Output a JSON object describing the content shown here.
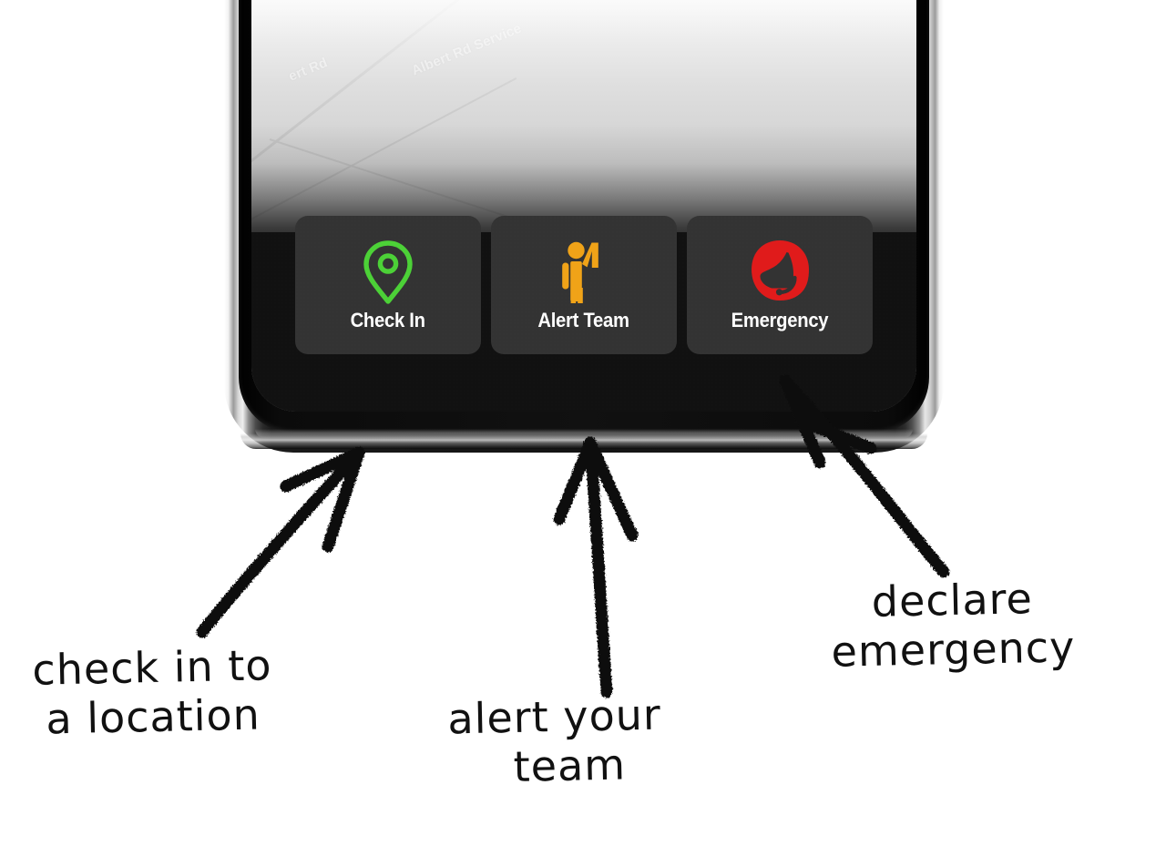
{
  "device": {
    "name": "smartphone-mockup",
    "frame_color": "#141414",
    "screen_bg": "#111111"
  },
  "map": {
    "labels": [
      {
        "text": "ert Rd",
        "rotation": -22
      },
      {
        "text": "Albert Rd Service",
        "rotation": -22
      }
    ]
  },
  "action_bar": {
    "name": "quick-actions",
    "buttons": [
      {
        "id": "check-in",
        "label": "Check In",
        "icon": "map-pin-icon",
        "icon_color": "#4CD137",
        "tile_color": "#333333"
      },
      {
        "id": "alert-team",
        "label": "Alert Team",
        "icon": "person-raised-hand-icon",
        "icon_color": "#F0A318",
        "tile_color": "#333333"
      },
      {
        "id": "emergency",
        "label": "Emergency",
        "icon": "headset-support-icon",
        "icon_color": "#E01B1B",
        "tile_color": "#333333"
      }
    ]
  },
  "annotations": [
    {
      "id": "annot-check-in",
      "text": "check in to\na location",
      "points_to": "check-in"
    },
    {
      "id": "annot-alert",
      "text": "alert your\n  team",
      "points_to": "alert-team"
    },
    {
      "id": "annot-emergency",
      "text": "declare\nemergency",
      "points_to": "emergency"
    }
  ]
}
